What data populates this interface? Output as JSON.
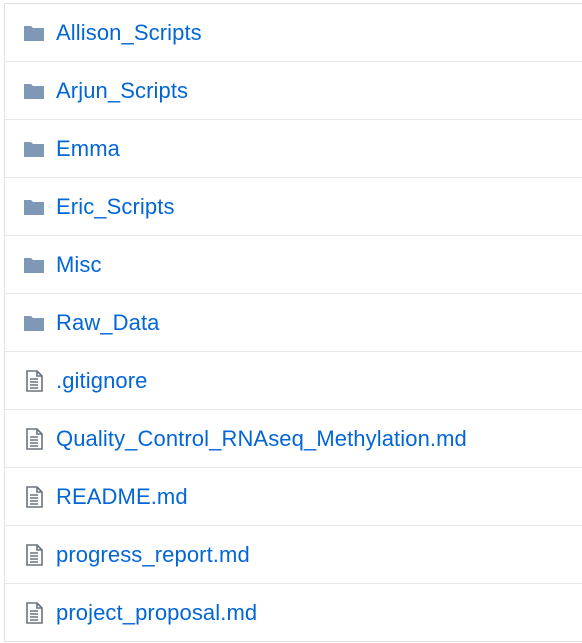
{
  "files": [
    {
      "name": "Allison_Scripts",
      "type": "directory",
      "icon": "folder-icon"
    },
    {
      "name": "Arjun_Scripts",
      "type": "directory",
      "icon": "folder-icon"
    },
    {
      "name": "Emma",
      "type": "directory",
      "icon": "folder-icon"
    },
    {
      "name": "Eric_Scripts",
      "type": "directory",
      "icon": "folder-icon"
    },
    {
      "name": "Misc",
      "type": "directory",
      "icon": "folder-icon"
    },
    {
      "name": "Raw_Data",
      "type": "directory",
      "icon": "folder-icon"
    },
    {
      "name": ".gitignore",
      "type": "file",
      "icon": "file-text-icon"
    },
    {
      "name": "Quality_Control_RNAseq_Methylation.md",
      "type": "file",
      "icon": "file-text-icon"
    },
    {
      "name": "README.md",
      "type": "file",
      "icon": "file-text-icon"
    },
    {
      "name": "progress_report.md",
      "type": "file",
      "icon": "file-text-icon"
    },
    {
      "name": "project_proposal.md",
      "type": "file",
      "icon": "file-text-icon"
    }
  ],
  "colors": {
    "link": "#0366d6",
    "folder_icon": "#79b8ff",
    "file_icon": "#6a737d",
    "border": "#e5e7ea"
  }
}
